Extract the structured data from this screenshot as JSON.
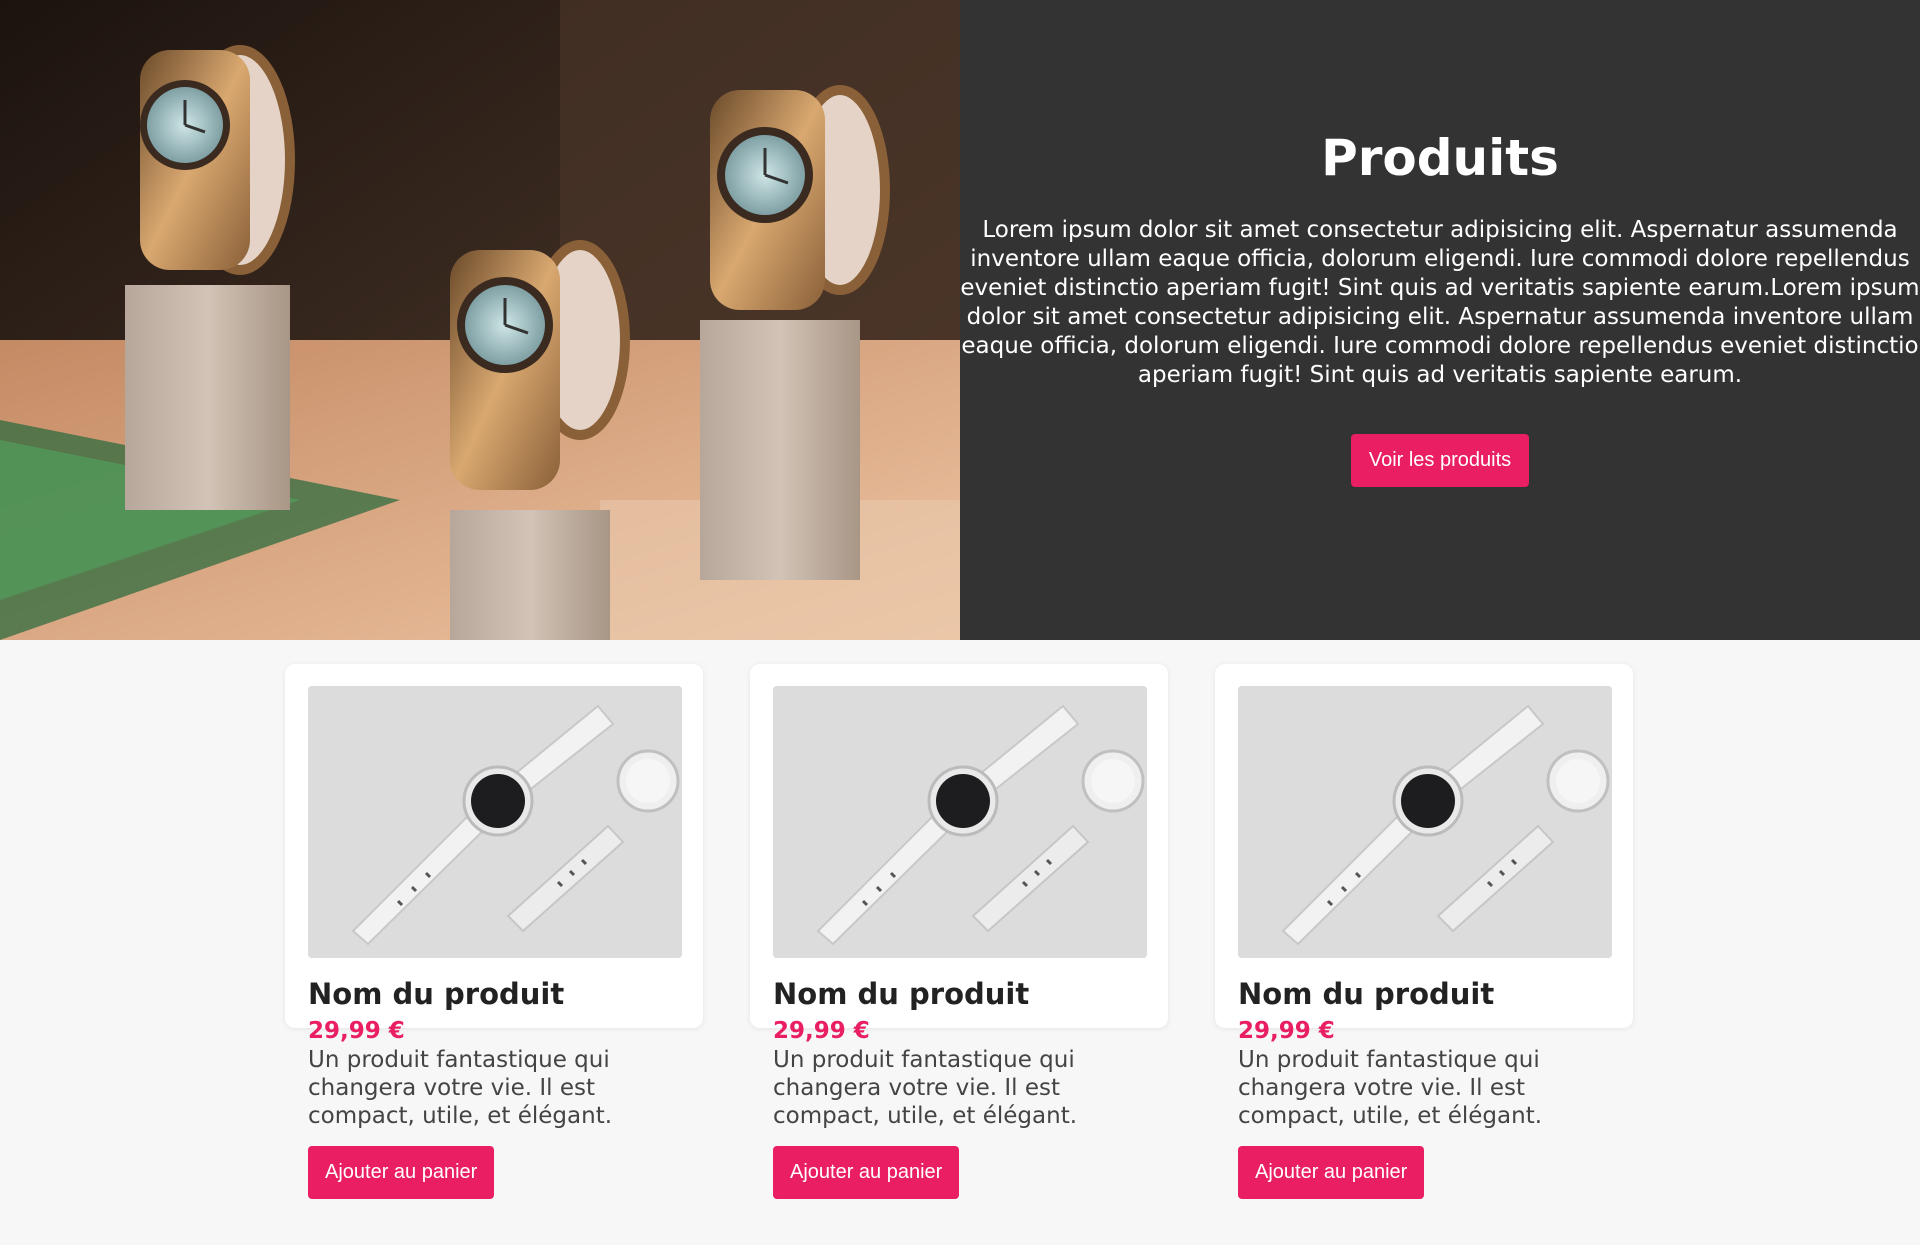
{
  "hero": {
    "title": "Produits",
    "description": "Lorem ipsum dolor sit amet consectetur adipisicing elit. Aspernatur assumenda inventore ullam eaque officia, dolorum eligendi. Iure commodi dolore repellendus eveniet distinctio aperiam fugit! Sint quis ad veritatis sapiente earum.Lorem ipsum dolor sit amet consectetur adipisicing elit. Aspernatur assumenda inventore ullam eaque officia, dolorum eligendi. Iure commodi dolore repellendus eveniet distinctio aperiam fugit! Sint quis ad veritatis sapiente earum.",
    "button_label": "Voir les produits"
  },
  "products": [
    {
      "name": "Nom du produit",
      "price": "29,99 €",
      "description": "Un produit fantastique qui changera votre vie. Il est compact, utile, et élégant.",
      "button_label": "Ajouter au panier"
    },
    {
      "name": "Nom du produit",
      "price": "29,99 €",
      "description": "Un produit fantastique qui changera votre vie. Il est compact, utile, et élégant.",
      "button_label": "Ajouter au panier"
    },
    {
      "name": "Nom du produit",
      "price": "29,99 €",
      "description": "Un produit fantastique qui changera votre vie. Il est compact, utile, et élégant.",
      "button_label": "Ajouter au panier"
    }
  ],
  "colors": {
    "accent": "#e91e63",
    "hero_background": "#333333",
    "page_background": "#f7f7f7",
    "card_background": "#ffffff"
  }
}
